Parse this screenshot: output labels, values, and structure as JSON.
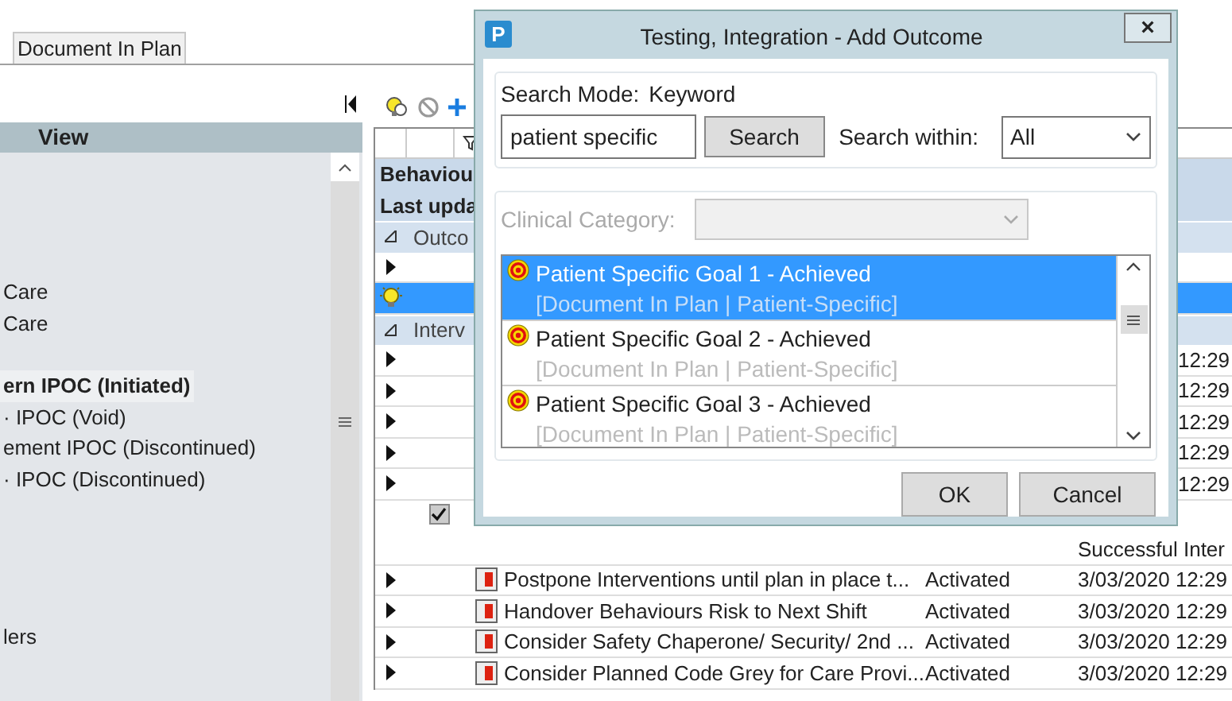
{
  "document_tab": {
    "label": "Document In Plan",
    "selected": true
  },
  "left_panel": {
    "header": "View",
    "groups": [
      [
        {
          "label": "Care",
          "selected": false
        },
        {
          "label": "Care",
          "selected": false
        }
      ],
      [
        {
          "label": "ern IPOC (Initiated)",
          "selected": true
        },
        {
          "label": "· IPOC (Void)",
          "selected": false
        },
        {
          "label": "ement IPOC (Discontinued)",
          "selected": false
        },
        {
          "label": "· IPOC (Discontinued)",
          "selected": false
        }
      ],
      [
        {
          "label": "lers",
          "selected": false
        }
      ]
    ]
  },
  "grid": {
    "title_rows": [
      "Behaviou",
      "Last upda"
    ],
    "sections": [
      {
        "label": "Outco",
        "expanded": true,
        "rows": [
          {
            "kind": "plain",
            "selected": false
          },
          {
            "kind": "bulb",
            "selected": true
          }
        ]
      },
      {
        "label": "Interv",
        "expanded": true,
        "rows": [
          {
            "kind": "plain",
            "selected": false,
            "date": "12:29"
          },
          {
            "kind": "plain",
            "selected": false,
            "date": "12:29"
          },
          {
            "kind": "plain",
            "selected": false,
            "date": "12:29"
          },
          {
            "kind": "plain",
            "selected": false,
            "date": "12:29"
          },
          {
            "kind": "plain",
            "selected": false,
            "date": "12:29"
          },
          {
            "kind": "checked",
            "selected": false,
            "note": "Successful Inter"
          },
          {
            "kind": "document",
            "selected": false,
            "name": "Postpone Interventions until plan in place t...",
            "status": "Activated",
            "date": "3/03/2020 12:29"
          },
          {
            "kind": "document",
            "selected": false,
            "name": "Handover Behaviours Risk to Next Shift",
            "status": "Activated",
            "date": "3/03/2020 12:29"
          },
          {
            "kind": "document",
            "selected": false,
            "name": "Consider Safety Chaperone/ Security/ 2nd ...",
            "status": "Activated",
            "date": "3/03/2020 12:29"
          },
          {
            "kind": "document",
            "selected": false,
            "name": "Consider Planned Code Grey for Care Provi...",
            "status": "Activated",
            "date": "3/03/2020 12:29"
          }
        ]
      }
    ]
  },
  "dialog": {
    "app_icon": "P",
    "title": "Testing, Integration - Add Outcome",
    "close": "×",
    "search_mode_label": "Search Mode:",
    "search_mode": "Keyword",
    "search_value": "patient specific",
    "search_button": "Search",
    "search_within_label": "Search within:",
    "search_within": "All",
    "clinical_category_label": "Clinical Category:",
    "clinical_category_disabled": true,
    "results": [
      {
        "title": "Patient Specific Goal 1 - Achieved",
        "detail": "[Document In Plan | Patient-Specific]",
        "selected": true
      },
      {
        "title": "Patient Specific Goal 2 - Achieved",
        "detail": "[Document In Plan | Patient-Specific]",
        "selected": false
      },
      {
        "title": "Patient Specific Goal 3 - Achieved",
        "detail": "[Document In Plan | Patient-Specific]",
        "selected": false
      }
    ],
    "buttons": [
      "OK",
      "Cancel"
    ]
  }
}
